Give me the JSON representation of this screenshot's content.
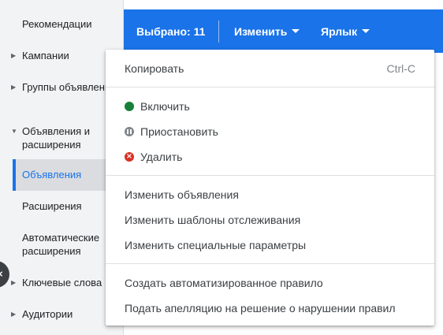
{
  "sidebar": {
    "items": [
      {
        "label": "Рекомендации"
      },
      {
        "label": "Кампании"
      },
      {
        "label": "Группы объявлений"
      },
      {
        "label": "Объявления и расширения"
      },
      {
        "label": "Объявления"
      },
      {
        "label": "Расширения"
      },
      {
        "label": "Автоматические расширения"
      },
      {
        "label": "Ключевые слова"
      },
      {
        "label": "Аудитории"
      }
    ],
    "collapse_icon": "chevron-left-icon"
  },
  "toolbar": {
    "selected": "Выбрано: 11",
    "edit_label": "Изменить",
    "label_label": "Ярлык",
    "background": "#1a73e8"
  },
  "menu": {
    "copy": {
      "label": "Копировать",
      "shortcut": "Ctrl-C"
    },
    "status": [
      {
        "label": "Включить",
        "icon": "enabled-dot-icon",
        "color": "#188038"
      },
      {
        "label": "Приостановить",
        "icon": "pause-icon",
        "color": "#80868b"
      },
      {
        "label": "Удалить",
        "icon": "remove-icon",
        "color": "#d93025"
      }
    ],
    "edit": [
      {
        "label": "Изменить объявления"
      },
      {
        "label": "Изменить шаблоны отслеживания"
      },
      {
        "label": "Изменить специальные параметры"
      }
    ],
    "rules": [
      {
        "label": "Создать автоматизированное правило"
      },
      {
        "label": "Подать апелляцию на решение о нарушении правил"
      }
    ]
  }
}
